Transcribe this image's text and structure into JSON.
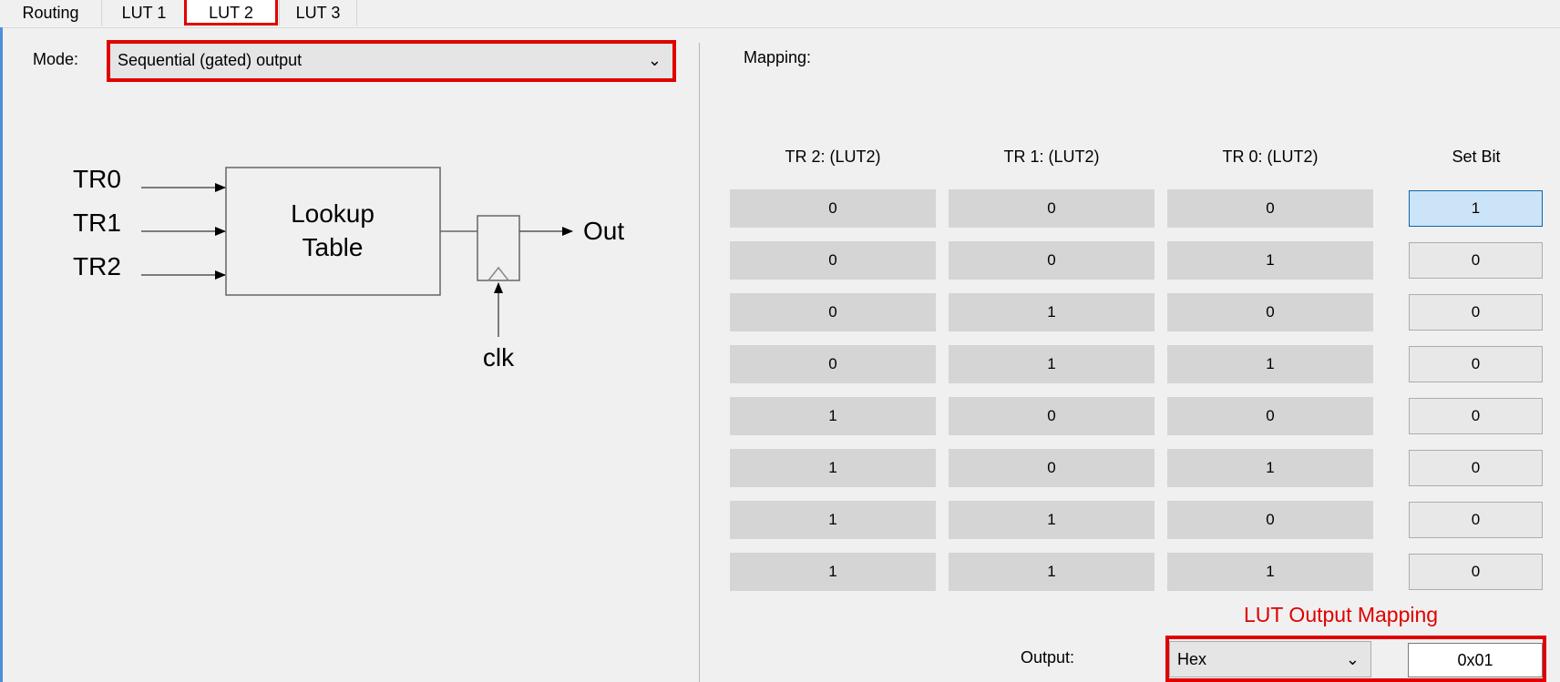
{
  "tabs": [
    {
      "label": "Routing"
    },
    {
      "label": "LUT 1"
    },
    {
      "label": "LUT 2"
    },
    {
      "label": "LUT 3"
    }
  ],
  "mode": {
    "label": "Mode:",
    "value": "Sequential (gated) output"
  },
  "diagram": {
    "inputs": [
      "TR0",
      "TR1",
      "TR2"
    ],
    "box_text": [
      "Lookup",
      "Table"
    ],
    "output": "Out",
    "clock": "clk"
  },
  "mapping": {
    "label": "Mapping:",
    "headers": [
      "TR 2:  (LUT2)",
      "TR 1:  (LUT2)",
      "TR 0:  (LUT2)",
      "Set Bit"
    ],
    "rows": [
      [
        "0",
        "0",
        "0",
        "1"
      ],
      [
        "0",
        "0",
        "1",
        "0"
      ],
      [
        "0",
        "1",
        "0",
        "0"
      ],
      [
        "0",
        "1",
        "1",
        "0"
      ],
      [
        "1",
        "0",
        "0",
        "0"
      ],
      [
        "1",
        "0",
        "1",
        "0"
      ],
      [
        "1",
        "1",
        "0",
        "0"
      ],
      [
        "1",
        "1",
        "1",
        "0"
      ]
    ]
  },
  "annotation": "LUT Output Mapping",
  "output": {
    "label": "Output:",
    "format": "Hex",
    "value": "0x01"
  },
  "colors": {
    "highlight": "#e00000",
    "selected": "#cce4f7"
  }
}
